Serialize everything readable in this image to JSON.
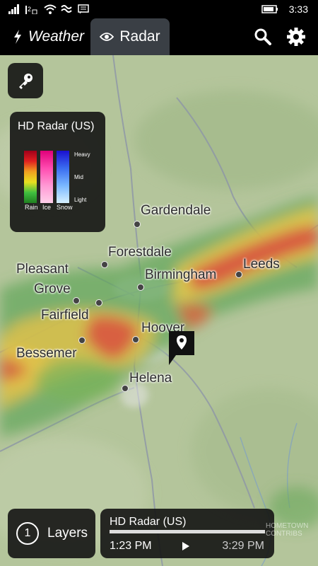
{
  "status_bar": {
    "time": "3:33"
  },
  "tabs": [
    {
      "label": "Weather",
      "icon": "lightning-icon",
      "selected": false
    },
    {
      "label": "Radar",
      "icon": "eye-icon",
      "selected": true
    }
  ],
  "actions": {
    "search_icon": "search-icon",
    "settings_icon": "gear-icon"
  },
  "legend": {
    "title": "HD Radar (US)",
    "levels": [
      "Heavy",
      "Mid",
      "Light"
    ],
    "types": [
      "Rain",
      "Ice",
      "Snow"
    ]
  },
  "map_labels": [
    "Gardendale",
    "Forestdale",
    "Birmingham",
    "Leeds",
    "Pleasant",
    "Grove",
    "Fairfield",
    "Hoover",
    "Bessemer",
    "Helena"
  ],
  "layers": {
    "count": "1",
    "label": "Layers"
  },
  "player": {
    "title": "HD Radar (US)",
    "start_time": "1:23 PM",
    "end_time": "3:29 PM",
    "progress": 1.0
  },
  "watermark": [
    "HOMETOWN",
    "CONTRIBS"
  ],
  "colors": {
    "accent": "#3a3f45",
    "map_bg": "#b5c69d"
  }
}
